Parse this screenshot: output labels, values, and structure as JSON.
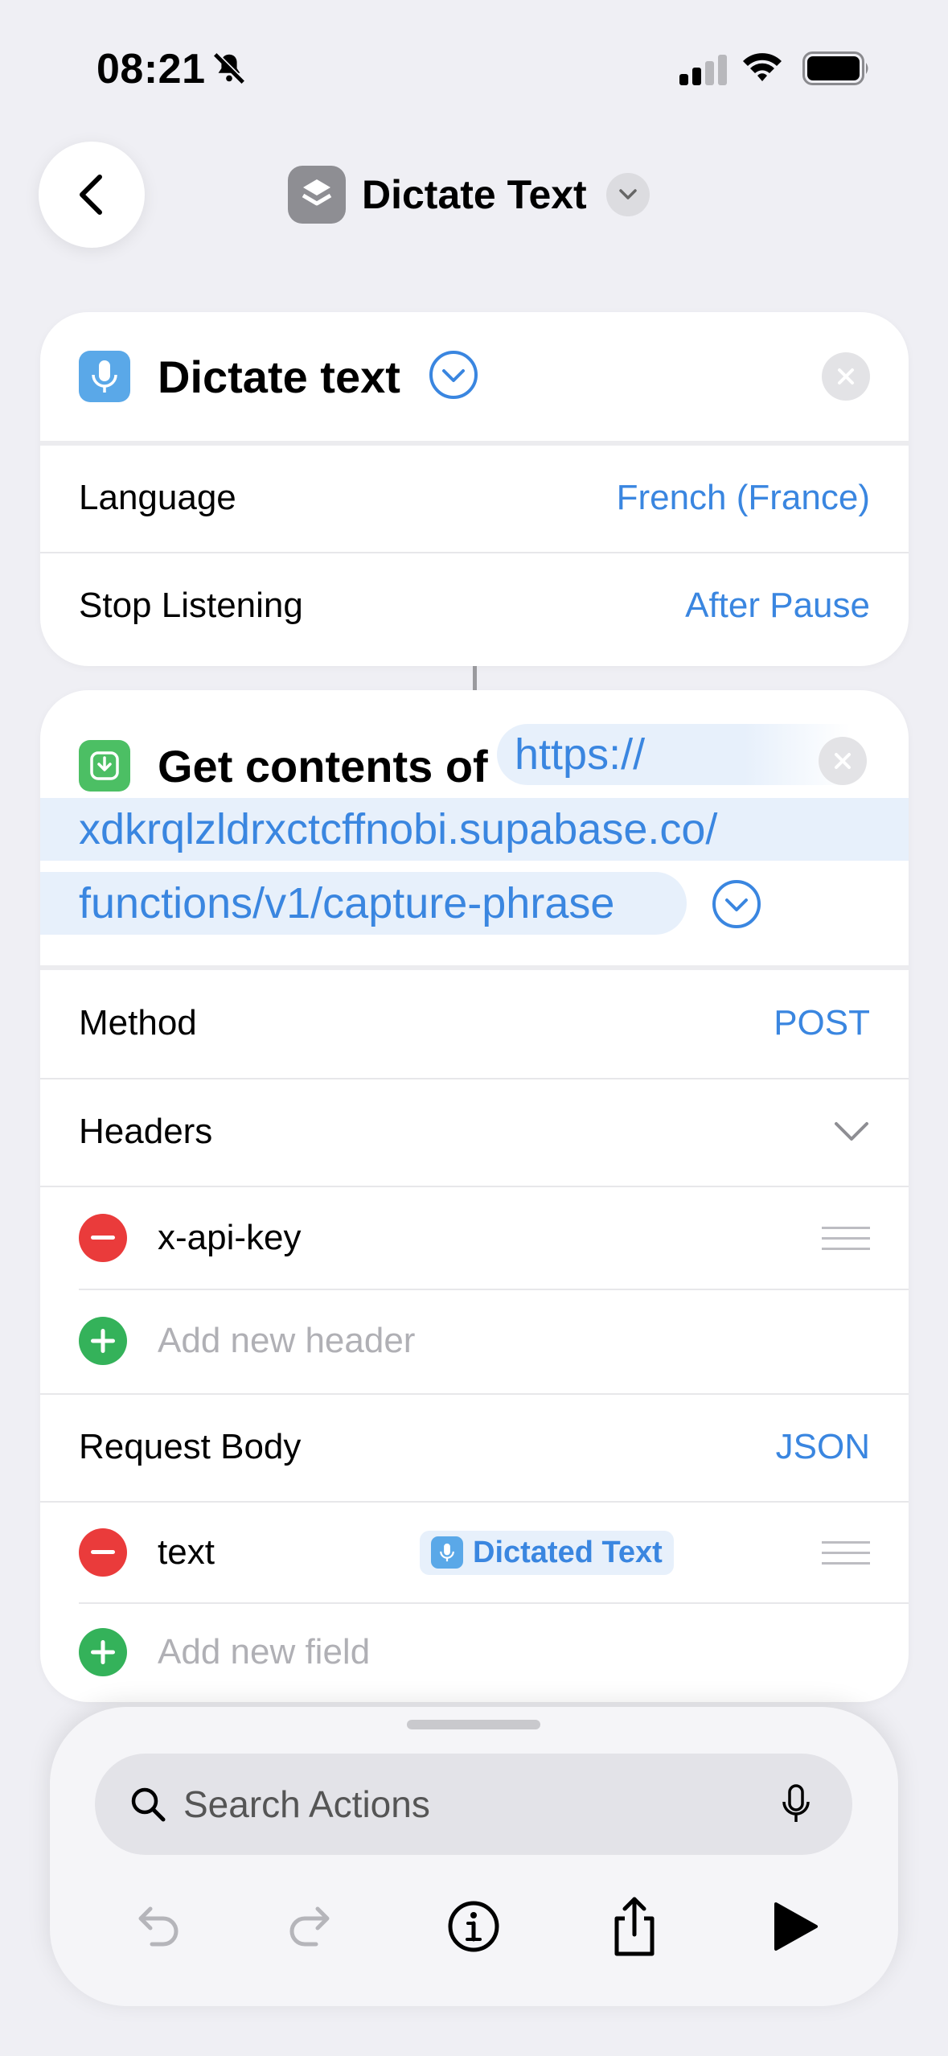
{
  "status_bar": {
    "time": "08:21"
  },
  "header": {
    "title": "Dictate Text"
  },
  "dictate_action": {
    "title": "Dictate text",
    "rows": [
      {
        "label": "Language",
        "value": "French (France)"
      },
      {
        "label": "Stop Listening",
        "value": "After Pause"
      }
    ]
  },
  "get_contents_action": {
    "title": "Get contents of",
    "url_line1": "https://",
    "url_line2": "xdkrqlzldrxctcffnobi.supabase.co/",
    "url_line3": "functions/v1/capture-phrase",
    "method_label": "Method",
    "method_value": "POST",
    "headers_label": "Headers",
    "header_items": [
      {
        "key": "x-api-key"
      }
    ],
    "add_header_label": "Add new header",
    "request_body_label": "Request Body",
    "request_body_value": "JSON",
    "body_fields": [
      {
        "key": "text",
        "value": "Dictated Text"
      }
    ],
    "add_field_label": "Add new field"
  },
  "bottom_sheet": {
    "search_placeholder": "Search Actions"
  },
  "colors": {
    "accent": "#3a86e0",
    "remove": "#ea3b3b",
    "add": "#34b25a"
  }
}
